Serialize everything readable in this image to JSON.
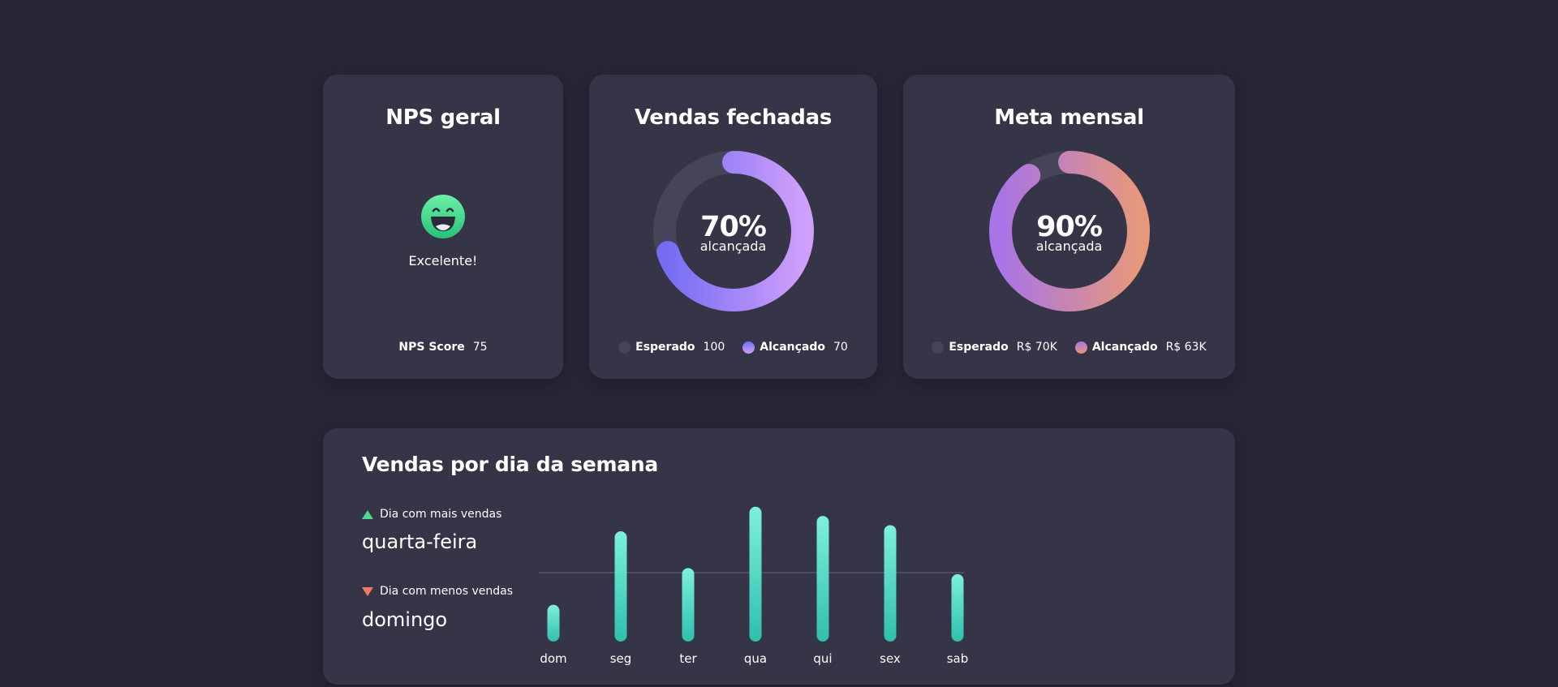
{
  "nps": {
    "title": "NPS geral",
    "emoji_icon": "smiling-face-icon",
    "label": "Excelente!",
    "score_label": "NPS Score",
    "score_value": "75"
  },
  "vendas": {
    "title": "Vendas fechadas",
    "percent": "70%",
    "percent_value": 70,
    "sub": "alcançada",
    "expected_label": "Esperado",
    "expected_value": "100",
    "achieved_label": "Alcançado",
    "achieved_value": "70"
  },
  "meta": {
    "title": "Meta mensal",
    "percent": "90%",
    "percent_value": 90,
    "sub": "alcançada",
    "expected_label": "Esperado",
    "expected_value": "R$ 70K",
    "achieved_label": "Alcançado",
    "achieved_value": "R$ 63K"
  },
  "semana": {
    "title": "Vendas por dia da semana",
    "most_label": "Dia com mais vendas",
    "most_day": "quarta-feira",
    "least_label": "Dia com menos vendas",
    "least_day": "domingo"
  },
  "chart_data": {
    "type": "bar",
    "categories": [
      "dom",
      "seg",
      "ter",
      "qua",
      "qui",
      "sex",
      "sab"
    ],
    "values": [
      24,
      72,
      48,
      88,
      82,
      76,
      44
    ],
    "reference_line": 45,
    "ylim": [
      0,
      90
    ],
    "grid": false
  },
  "colors": {
    "background": "#272536",
    "card": "#363447",
    "track": "#46445a",
    "purple_start": "#746cf3",
    "purple_end": "#cf9ffb",
    "meta_start": "#a874e7",
    "meta_end": "#e7987a",
    "bar_top": "#7cf0dd",
    "bar_bottom": "#2fc0ab",
    "up": "#4ed891",
    "down": "#f07a66"
  }
}
